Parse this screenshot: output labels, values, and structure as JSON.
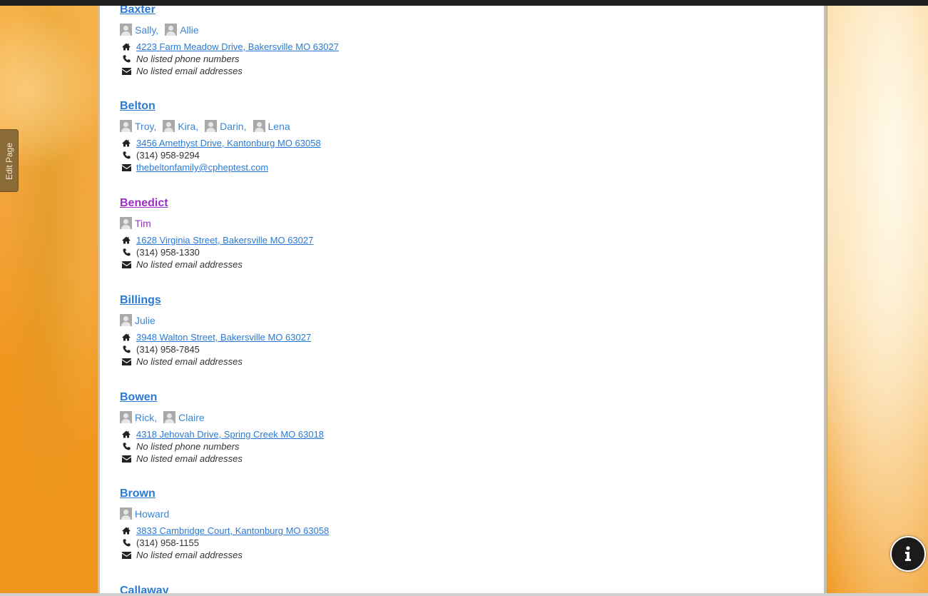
{
  "edit_tab_label": "Edit Page",
  "info_button_label": "i",
  "families": [
    {
      "name": "Baxter",
      "visited": false,
      "members": [
        "Sally,",
        "Allie"
      ],
      "address": "4223 Farm Meadow Drive, Bakersville MO 63027",
      "phone": "No listed phone numbers",
      "phone_listed": false,
      "email": "No listed email addresses",
      "email_listed": false
    },
    {
      "name": "Belton",
      "visited": false,
      "members": [
        "Troy,",
        "Kira,",
        "Darin,",
        "Lena"
      ],
      "address": "3456 Amethyst Drive, Kantonburg MO 63058",
      "phone": "(314) 958-9294",
      "phone_listed": true,
      "email": "thebeltonfamily@cpheptest.com",
      "email_listed": true
    },
    {
      "name": "Benedict",
      "visited": true,
      "members": [
        "Tim"
      ],
      "address": "1628 Virginia Street, Bakersville MO 63027",
      "phone": "(314) 958-1330",
      "phone_listed": true,
      "email": "No listed email addresses",
      "email_listed": false
    },
    {
      "name": "Billings",
      "visited": false,
      "members": [
        "Julie"
      ],
      "address": "3948 Walton Street, Bakersville MO 63027",
      "phone": "(314) 958-7845",
      "phone_listed": true,
      "email": "No listed email addresses",
      "email_listed": false
    },
    {
      "name": "Bowen",
      "visited": false,
      "members": [
        "Rick,",
        "Claire"
      ],
      "address": "4318 Jehovah Drive, Spring Creek MO 63018",
      "phone": "No listed phone numbers",
      "phone_listed": false,
      "email": "No listed email addresses",
      "email_listed": false
    },
    {
      "name": "Brown",
      "visited": false,
      "members": [
        "Howard"
      ],
      "address": "3833 Cambridge Court, Kantonburg MO 63058",
      "phone": "(314) 958-1155",
      "phone_listed": true,
      "email": "No listed email addresses",
      "email_listed": false
    },
    {
      "name": "Callaway",
      "visited": false,
      "members": [],
      "address": "",
      "phone": "",
      "phone_listed": false,
      "email": "",
      "email_listed": false
    }
  ]
}
